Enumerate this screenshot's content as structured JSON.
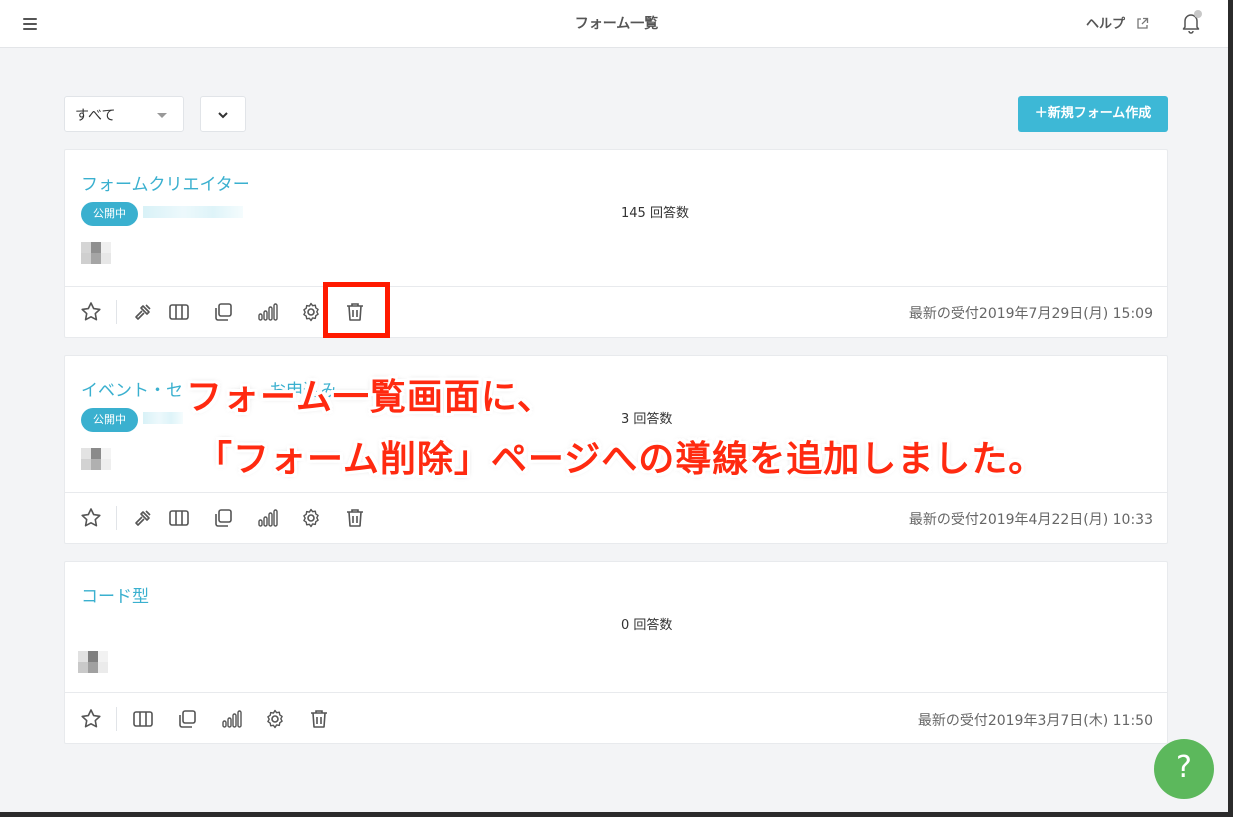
{
  "header": {
    "title": "フォーム一覧",
    "help_label": "ヘルプ"
  },
  "filters": {
    "status_value": "すべて",
    "new_form_label": "＋新規フォーム作成"
  },
  "forms": [
    {
      "title": "フォームクリエイター",
      "status": "公開中",
      "responses": "145 回答数",
      "last_received": "最新の受付2019年7月29日(月) 15:09"
    },
    {
      "title": "イベント・セ",
      "title_tail": "お申込み",
      "status": "公開中",
      "responses": "3 回答数",
      "last_received": "最新の受付2019年4月22日(月) 10:33"
    },
    {
      "title": "コード型",
      "responses": "0 回答数",
      "last_received": "最新の受付2019年3月7日(木) 11:50"
    }
  ],
  "annotation": {
    "line1": "フォーム一覧画面に、",
    "line2": "「フォーム削除」ページへの導線を追加しました。"
  },
  "help_fab_label": "?",
  "icons": [
    "menu-icon",
    "external-link-icon",
    "bell-icon",
    "chevron-down-icon",
    "star-icon",
    "hammer-icon",
    "columns-icon",
    "copy-icon",
    "bar-chart-icon",
    "gear-icon",
    "trash-icon"
  ],
  "colors": {
    "accent": "#3db8d6",
    "annotation": "#ff2a10",
    "help_fab": "#5cb85c"
  }
}
